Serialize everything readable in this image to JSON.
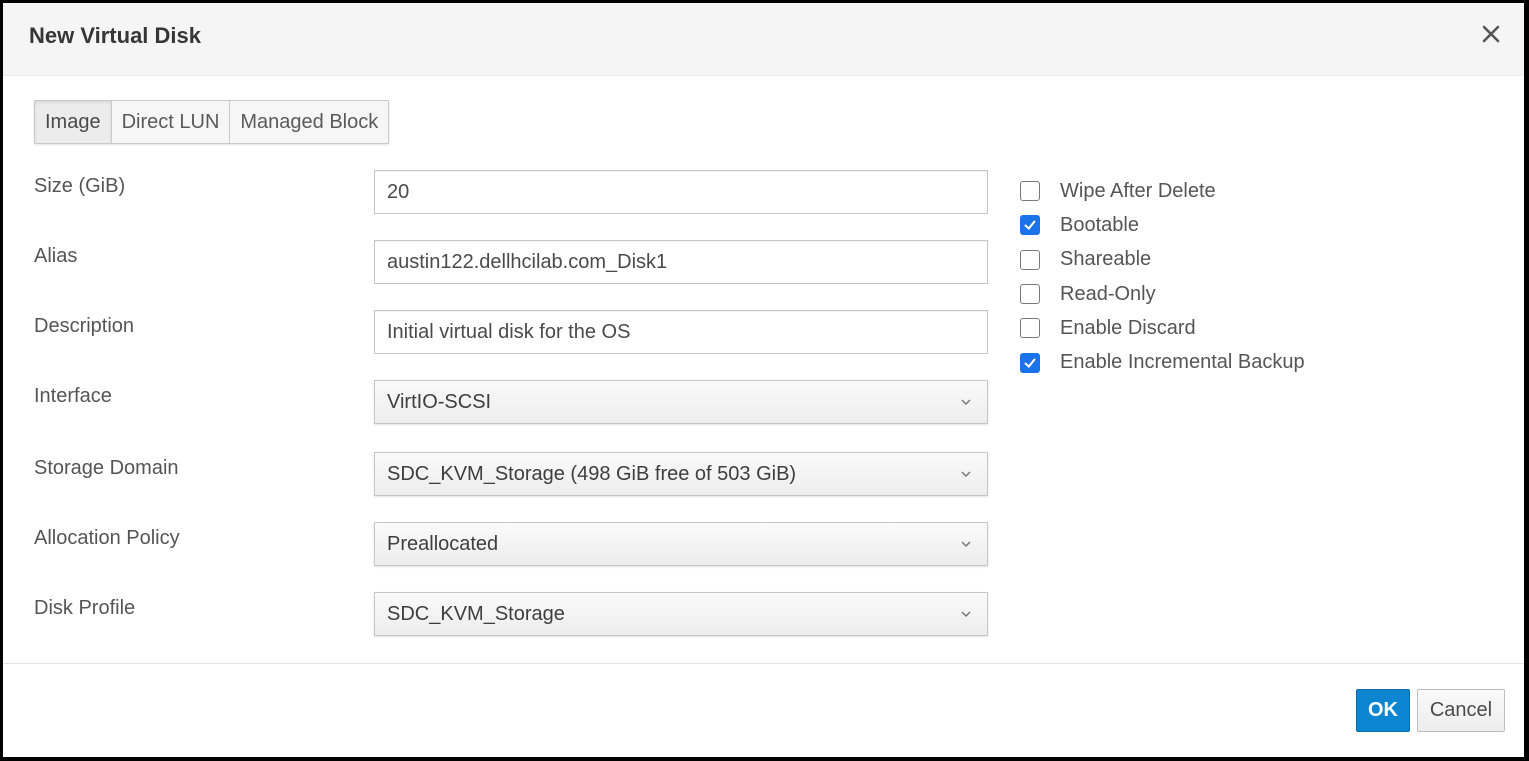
{
  "dialog": {
    "title": "New Virtual Disk",
    "close_icon": "close-icon"
  },
  "tabs": [
    {
      "label": "Image",
      "active": true
    },
    {
      "label": "Direct LUN",
      "active": false
    },
    {
      "label": "Managed Block",
      "active": false
    }
  ],
  "form": {
    "size": {
      "label": "Size (GiB)",
      "value": "20"
    },
    "alias": {
      "label": "Alias",
      "value": "austin122.dellhcilab.com_Disk1"
    },
    "description": {
      "label": "Description",
      "value": "Initial virtual disk for the OS"
    },
    "interface": {
      "label": "Interface",
      "value": "VirtIO-SCSI"
    },
    "storage_domain": {
      "label": "Storage Domain",
      "value": "SDC_KVM_Storage (498 GiB free of 503 GiB)"
    },
    "allocation_policy": {
      "label": "Allocation Policy",
      "value": "Preallocated"
    },
    "disk_profile": {
      "label": "Disk Profile",
      "value": "SDC_KVM_Storage"
    }
  },
  "options": [
    {
      "label": "Wipe After Delete",
      "checked": false
    },
    {
      "label": "Bootable",
      "checked": true
    },
    {
      "label": "Shareable",
      "checked": false
    },
    {
      "label": "Read-Only",
      "checked": false
    },
    {
      "label": "Enable Discard",
      "checked": false
    },
    {
      "label": "Enable Incremental Backup",
      "checked": true
    }
  ],
  "footer": {
    "ok_label": "OK",
    "cancel_label": "Cancel"
  },
  "colors": {
    "primary": "#0d85d0",
    "checkbox_checked": "#1a73e8"
  }
}
